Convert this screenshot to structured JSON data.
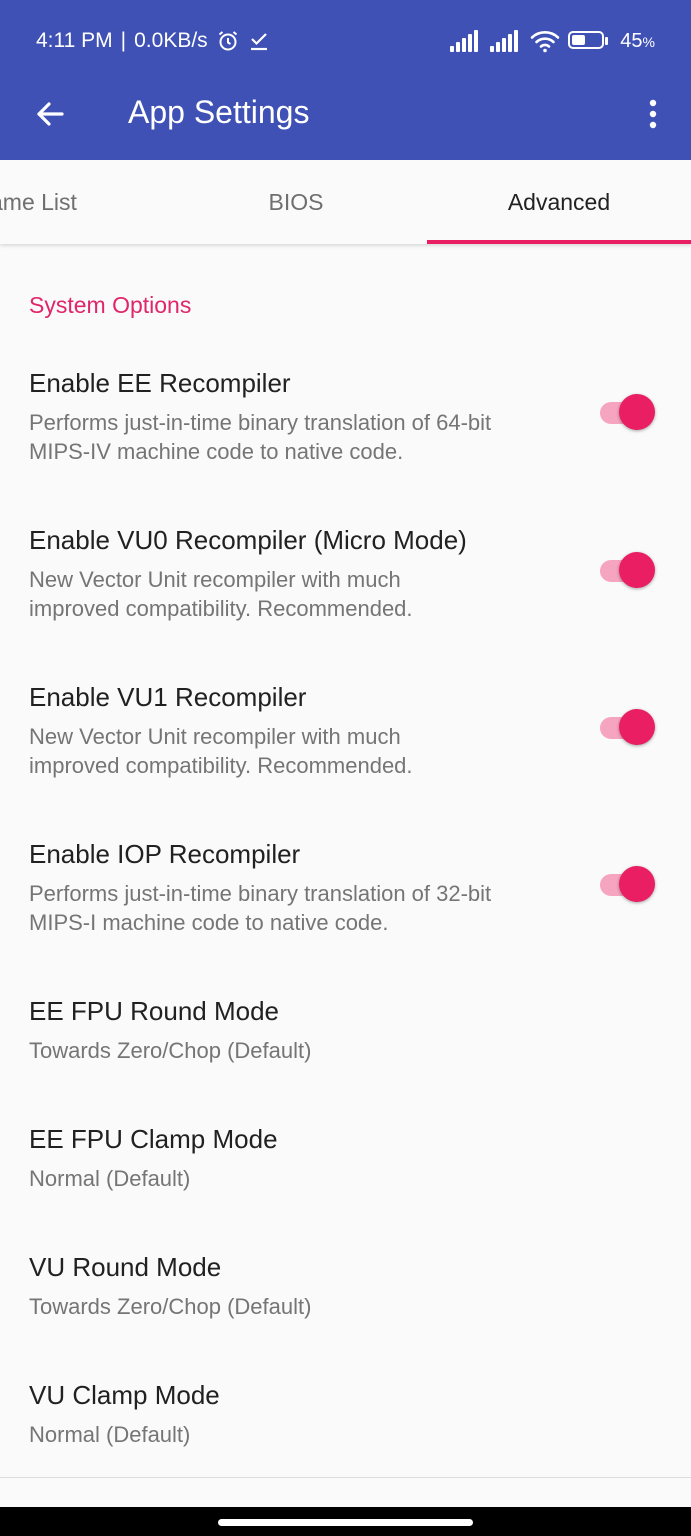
{
  "status_bar": {
    "time": "4:11 PM",
    "separator": "|",
    "network_speed": "0.0KB/s",
    "battery_percent": "45",
    "battery_unit": "%",
    "battery_level": 0.45,
    "icons": [
      "alarm-icon",
      "check-download-icon",
      "signal-icon",
      "signal-icon",
      "wifi-icon",
      "battery-icon"
    ]
  },
  "app_bar": {
    "title": "App Settings",
    "back_icon": "arrow-left-icon",
    "menu_icon": "more-vert-icon",
    "color": "#3f51b5"
  },
  "tabs": [
    {
      "label": "Game List",
      "visible_label": "ame List",
      "active": false
    },
    {
      "label": "BIOS",
      "active": false
    },
    {
      "label": "Advanced",
      "active": true
    }
  ],
  "accent_color": "#e91e63",
  "section": {
    "header": "System Options"
  },
  "preferences": [
    {
      "title": "Enable EE Recompiler",
      "summary": "Performs just-in-time binary translation of 64-bit MIPS-IV machine code to native code.",
      "switch": true
    },
    {
      "title": "Enable VU0 Recompiler (Micro Mode)",
      "summary": "New Vector Unit recompiler with much improved compatibility. Recommended.",
      "switch": true
    },
    {
      "title": "Enable VU1 Recompiler",
      "summary": "New Vector Unit recompiler with much improved compatibility. Recommended.",
      "switch": true
    },
    {
      "title": "Enable IOP Recompiler",
      "summary": "Performs just-in-time binary translation of 32-bit MIPS-I machine code to native code.",
      "switch": true
    },
    {
      "title": "EE FPU Round Mode",
      "summary": "Towards Zero/Chop (Default)"
    },
    {
      "title": "EE FPU Clamp Mode",
      "summary": "Normal (Default)"
    },
    {
      "title": "VU Round Mode",
      "summary": "Towards Zero/Chop (Default)"
    },
    {
      "title": "VU Clamp Mode",
      "summary": "Normal (Default)"
    }
  ]
}
